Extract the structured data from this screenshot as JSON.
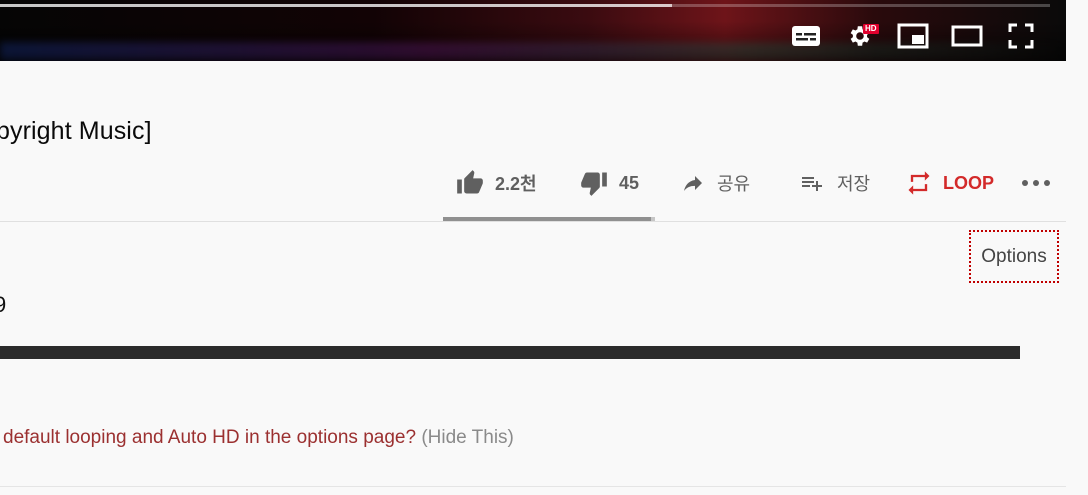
{
  "player": {
    "progress_fraction": 0.64,
    "hd_badge": "HD",
    "controls": [
      "subtitles-icon",
      "settings-icon",
      "miniplayer-icon",
      "theater-mode-icon",
      "fullscreen-icon"
    ]
  },
  "video": {
    "title": "pyright Music]"
  },
  "actions": {
    "like_count": "2.2천",
    "dislike_count": "45",
    "share_label": "공유",
    "save_label": "저장",
    "loop_label": "LOOP",
    "more_icon": "more-horiz-icon",
    "like_fraction": 0.98
  },
  "colors": {
    "loop_accent": "#d32a2a",
    "options_border": "#c00000",
    "notice_text": "#9b3030"
  },
  "description": {
    "options_label": "Options",
    "fragment_text": "9",
    "notice_question": " default looping and Auto HD in the options page?",
    "notice_hide": "(Hide This)"
  }
}
